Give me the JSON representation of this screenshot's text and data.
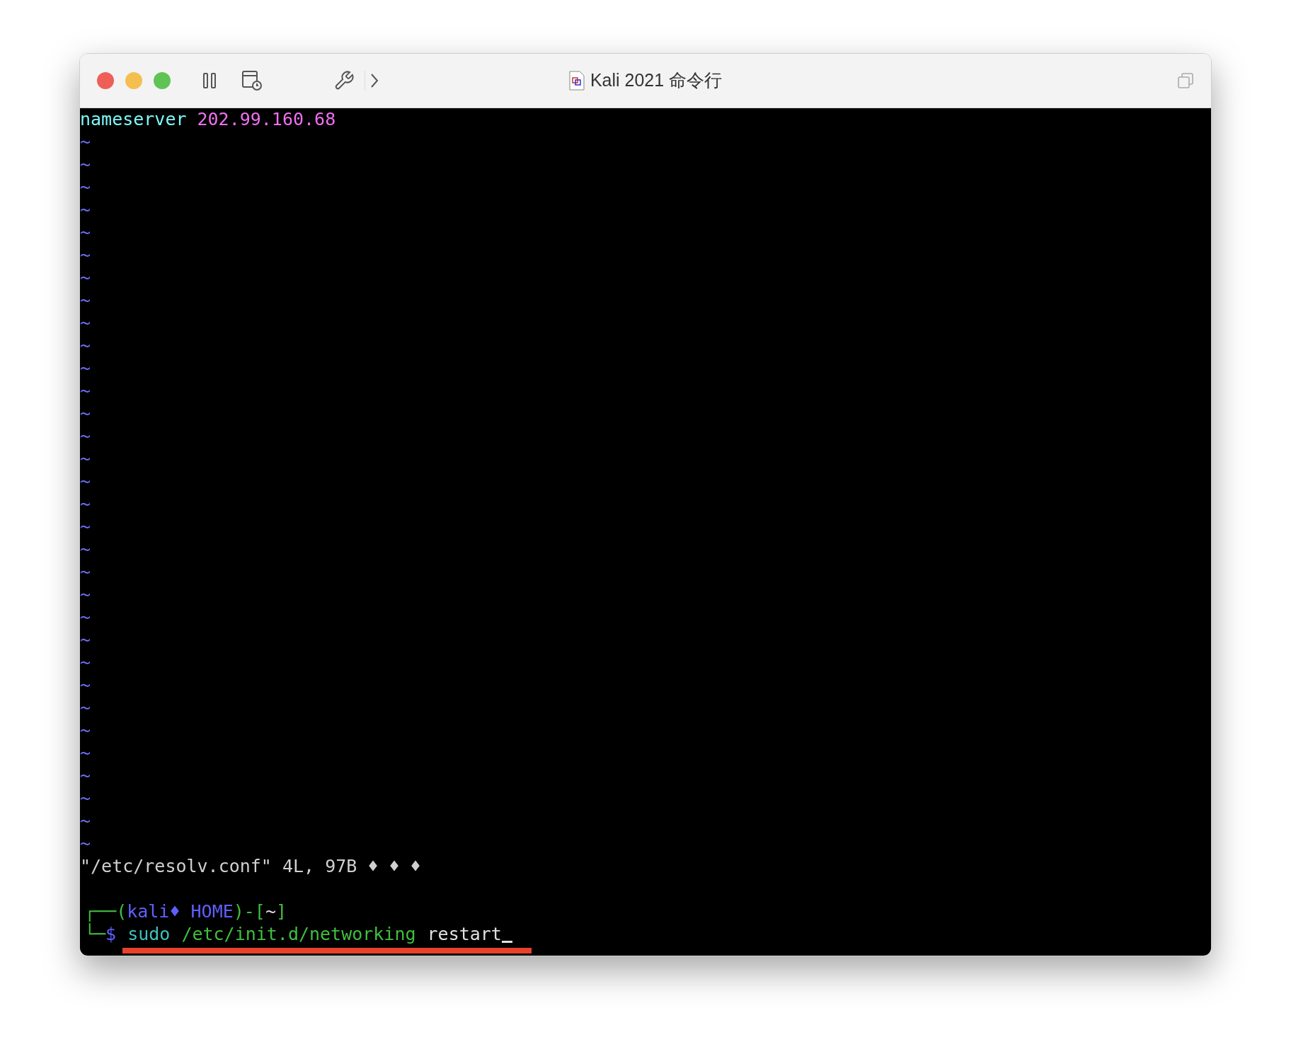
{
  "window": {
    "title": "Kali 2021 命令行"
  },
  "editor": {
    "lines": [
      {
        "key": "nameserver",
        "value": "202.99.160.68"
      }
    ],
    "tildes": [
      "~",
      "~",
      "~",
      "~",
      "~",
      "~",
      "~",
      "~",
      "~",
      "~",
      "~",
      "~",
      "~",
      "~",
      "~",
      "~",
      "~",
      "~",
      "~",
      "~",
      "~",
      "~",
      "~",
      "~",
      "~",
      "~",
      "~",
      "~",
      "~",
      "~",
      "~",
      "~"
    ],
    "status": "\"/etc/resolv.conf\" 4L, 97B ♦ ♦ ♦"
  },
  "prompt": {
    "top": [
      {
        "text": "┌──(",
        "color": "#3fbf3f"
      },
      {
        "text": "kali♦ HOME",
        "color": "#5f5fff"
      },
      {
        "text": ")-[",
        "color": "#3fbf3f"
      },
      {
        "text": "~",
        "color": "#e0e0e0"
      },
      {
        "text": "]",
        "color": "#3fbf3f"
      }
    ],
    "bottom": [
      {
        "text": "└─",
        "color": "#3fbf3f"
      },
      {
        "text": "$",
        "color": "#5f5fff"
      },
      {
        "text": "sudo",
        "color": "#3fbfbf"
      },
      {
        "text": "/etc/init.d/networking",
        "color": "#3fbf3f"
      },
      {
        "text": "restart",
        "color": "#e0e0e0"
      }
    ]
  }
}
